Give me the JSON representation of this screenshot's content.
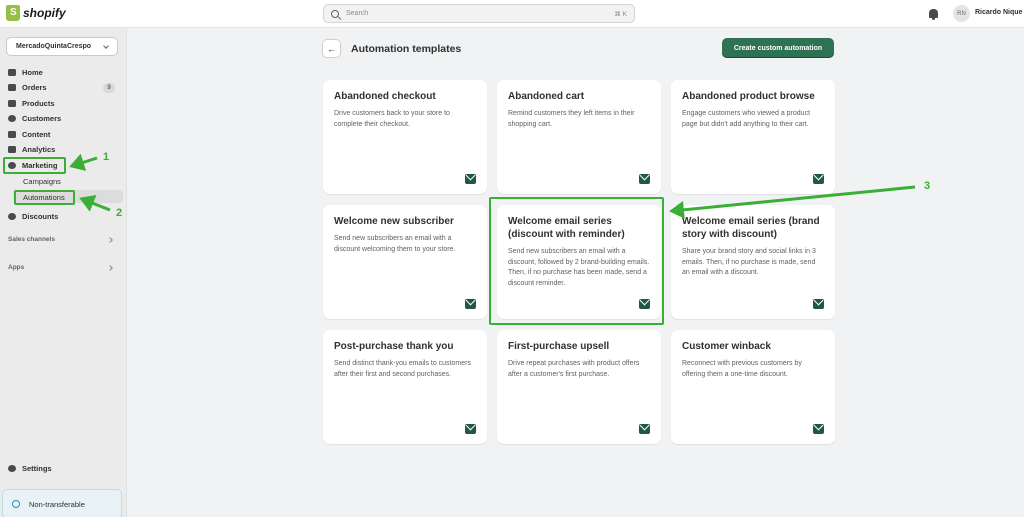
{
  "topbar": {
    "brand": "shopify",
    "search_placeholder": "Search",
    "search_shortcut": "⌘ K",
    "user_initials": "RN",
    "user_name": "Ricardo Nique"
  },
  "sidebar": {
    "store_name": "MercadoQuintaCrespo",
    "items": {
      "home": "Home",
      "orders": "Orders",
      "orders_badge": "9",
      "products": "Products",
      "customers": "Customers",
      "content": "Content",
      "analytics": "Analytics",
      "marketing": "Marketing",
      "campaigns": "Campaigns",
      "automations": "Automations",
      "discounts": "Discounts"
    },
    "sales_channels": "Sales channels",
    "apps": "Apps",
    "settings": "Settings",
    "non_transferable": "Non-transferable"
  },
  "page": {
    "title": "Automation templates",
    "create_button": "Create custom automation"
  },
  "cards": [
    {
      "title": "Abandoned checkout",
      "desc": "Drive customers back to your store to complete their checkout."
    },
    {
      "title": "Abandoned cart",
      "desc": "Remind customers they left items in their shopping cart."
    },
    {
      "title": "Abandoned product browse",
      "desc": "Engage customers who viewed a product page but didn't add anything to their cart."
    },
    {
      "title": "Welcome new subscriber",
      "desc": "Send new subscribers an email with a discount welcoming them to your store."
    },
    {
      "title": "Welcome email series (discount with reminder)",
      "desc": "Send new subscribers an email with a discount, followed by 2 brand-building emails. Then, if no purchase has been made, send a discount reminder."
    },
    {
      "title": "Welcome email series (brand story with discount)",
      "desc": "Share your brand story and social links in 3 emails. Then, if no purchase is made, send an email with a discount."
    },
    {
      "title": "Post-purchase thank you",
      "desc": "Send distinct thank-you emails to customers after their first and second purchases."
    },
    {
      "title": "First-purchase upsell",
      "desc": "Drive repeat purchases with product offers after a customer's first purchase."
    },
    {
      "title": "Customer winback",
      "desc": "Reconnect with previous customers by offering them a one-time discount."
    }
  ],
  "annotations": {
    "n1": "1",
    "n2": "2",
    "n3": "3",
    "color": "#3aae35"
  }
}
